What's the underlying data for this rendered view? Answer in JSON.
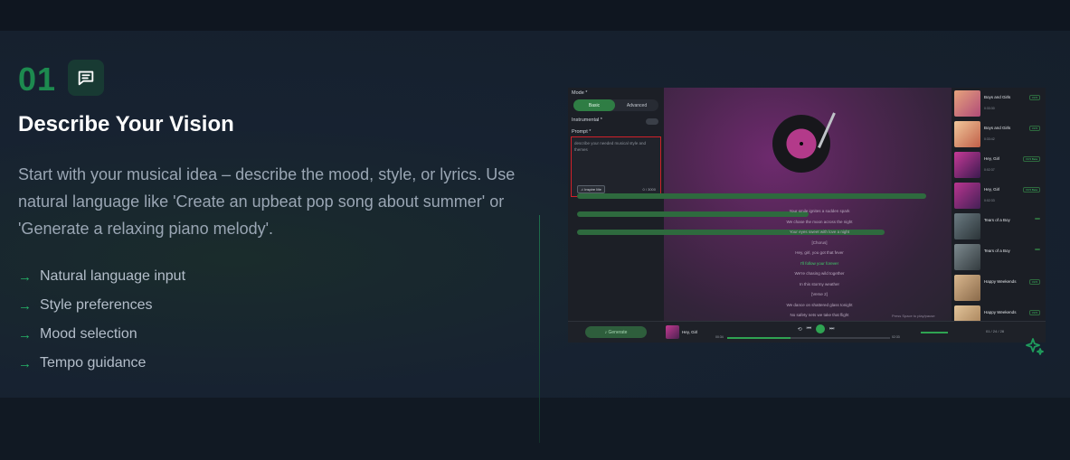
{
  "step": {
    "number": "01",
    "icon": "chat-message-icon",
    "title": "Describe Your Vision",
    "description": "Start with your musical idea – describe the mood, style, or lyrics. Use natural language like 'Create an upbeat pop song about summer' or 'Generate a relaxing piano melody'.",
    "features": [
      {
        "label": "Natural language input"
      },
      {
        "label": "Style preferences"
      },
      {
        "label": "Mood selection"
      },
      {
        "label": "Tempo guidance"
      }
    ],
    "accent_color": "#1d8a4f"
  },
  "screenshot": {
    "controls": {
      "mode_label": "Mode *",
      "mode_options": [
        "Basic",
        "Advanced"
      ],
      "instrumental_label": "Instrumental *",
      "prompt_label": "Prompt *",
      "prompt_placeholder": "describe your needed musical style and themes",
      "inspire_button": "Inspire Me",
      "char_counter": "0 / 3000",
      "generate_button": "Generate"
    },
    "lyrics": [
      {
        "text": "Your smile ignites a sudden spark"
      },
      {
        "text": "We chase the moon across the night"
      },
      {
        "text": "Your eyes sweet with love a night"
      },
      {
        "text": "[Chorus]"
      },
      {
        "text": "Hey, girl, you got that fever"
      },
      {
        "text": "I'll follow your forever"
      },
      {
        "text": "We're chasing wild together"
      },
      {
        "text": "In this stormy weather"
      },
      {
        "text": "[Verse 2]"
      },
      {
        "text": "We dance on shattered glass tonight"
      },
      {
        "text": "No safety nets we take that flight"
      }
    ],
    "lyrics_hint": "Press Space to play/pause",
    "songs": [
      {
        "title": "Boys and Girls",
        "time": "0:33:30",
        "badge": "V3.5"
      },
      {
        "title": "Boys and Girls",
        "time": "0:33:42",
        "badge": "V3.5"
      },
      {
        "title": "Hey, Girl",
        "time": "0:02:37",
        "badge": "V3.5 Beta"
      },
      {
        "title": "Hey, Girl",
        "time": "0:02:33",
        "badge": "V3.5 Beta"
      },
      {
        "title": "Tears of a Boy",
        "time": "",
        "badge": ""
      },
      {
        "title": "Tears of a Boy",
        "time": "",
        "badge": ""
      },
      {
        "title": "Happy Weekends",
        "time": "",
        "badge": "V3.5"
      },
      {
        "title": "Happy Weekends",
        "time": "",
        "badge": "V3.5"
      }
    ],
    "player": {
      "now_playing": "Hey, Girl",
      "time_start": "00:34",
      "time_end": "02:33",
      "pager": "01 / 24 / 28"
    }
  }
}
